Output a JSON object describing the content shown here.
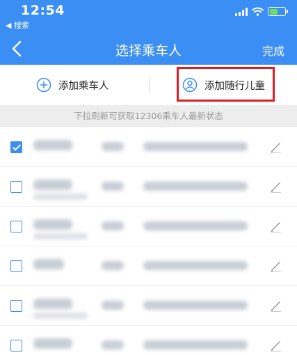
{
  "status_bar": {
    "time": "12:54",
    "back_label": "◀ 搜索"
  },
  "nav": {
    "title": "选择乘车人",
    "done_label": "完成"
  },
  "actions": {
    "add_passenger": "添加乘车人",
    "add_child": "添加随行儿童"
  },
  "hint": "下拉刷新可获取12306乘车人最新状态",
  "passengers": [
    {
      "checked": true
    },
    {
      "checked": false
    },
    {
      "checked": false
    },
    {
      "checked": false
    },
    {
      "checked": false
    },
    {
      "checked": false
    }
  ],
  "colors": {
    "primary": "#3a8ef4",
    "highlight": "#e21b23",
    "battery": "#6ee05a"
  }
}
